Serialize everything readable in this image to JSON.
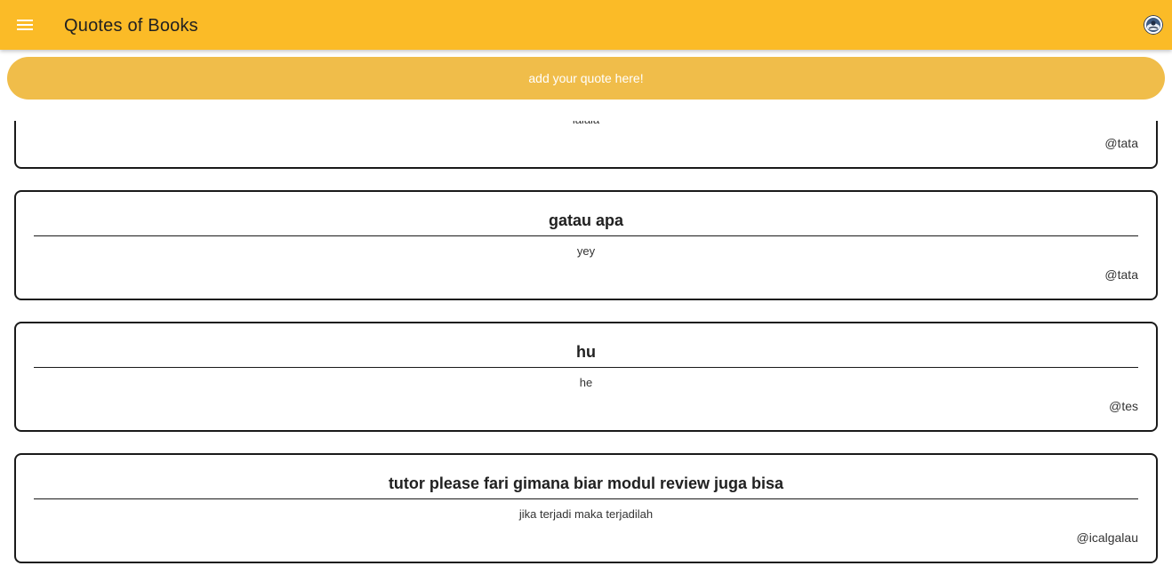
{
  "appbar": {
    "title": "Quotes of Books",
    "menu_icon": "menu-icon",
    "avatar_icon": "profile-avatar-icon",
    "color": "#fbbb27"
  },
  "add_button": {
    "label": "add your quote here!",
    "color": "#f0bd4a"
  },
  "quotes": [
    {
      "title": "",
      "body": "lalala",
      "author": "@tata"
    },
    {
      "title": "gatau apa",
      "body": "yey",
      "author": "@tata"
    },
    {
      "title": "hu",
      "body": "he",
      "author": "@tes"
    },
    {
      "title": "tutor please fari gimana biar modul review juga bisa",
      "body": "jika terjadi maka terjadilah",
      "author": "@icalgalau"
    }
  ]
}
